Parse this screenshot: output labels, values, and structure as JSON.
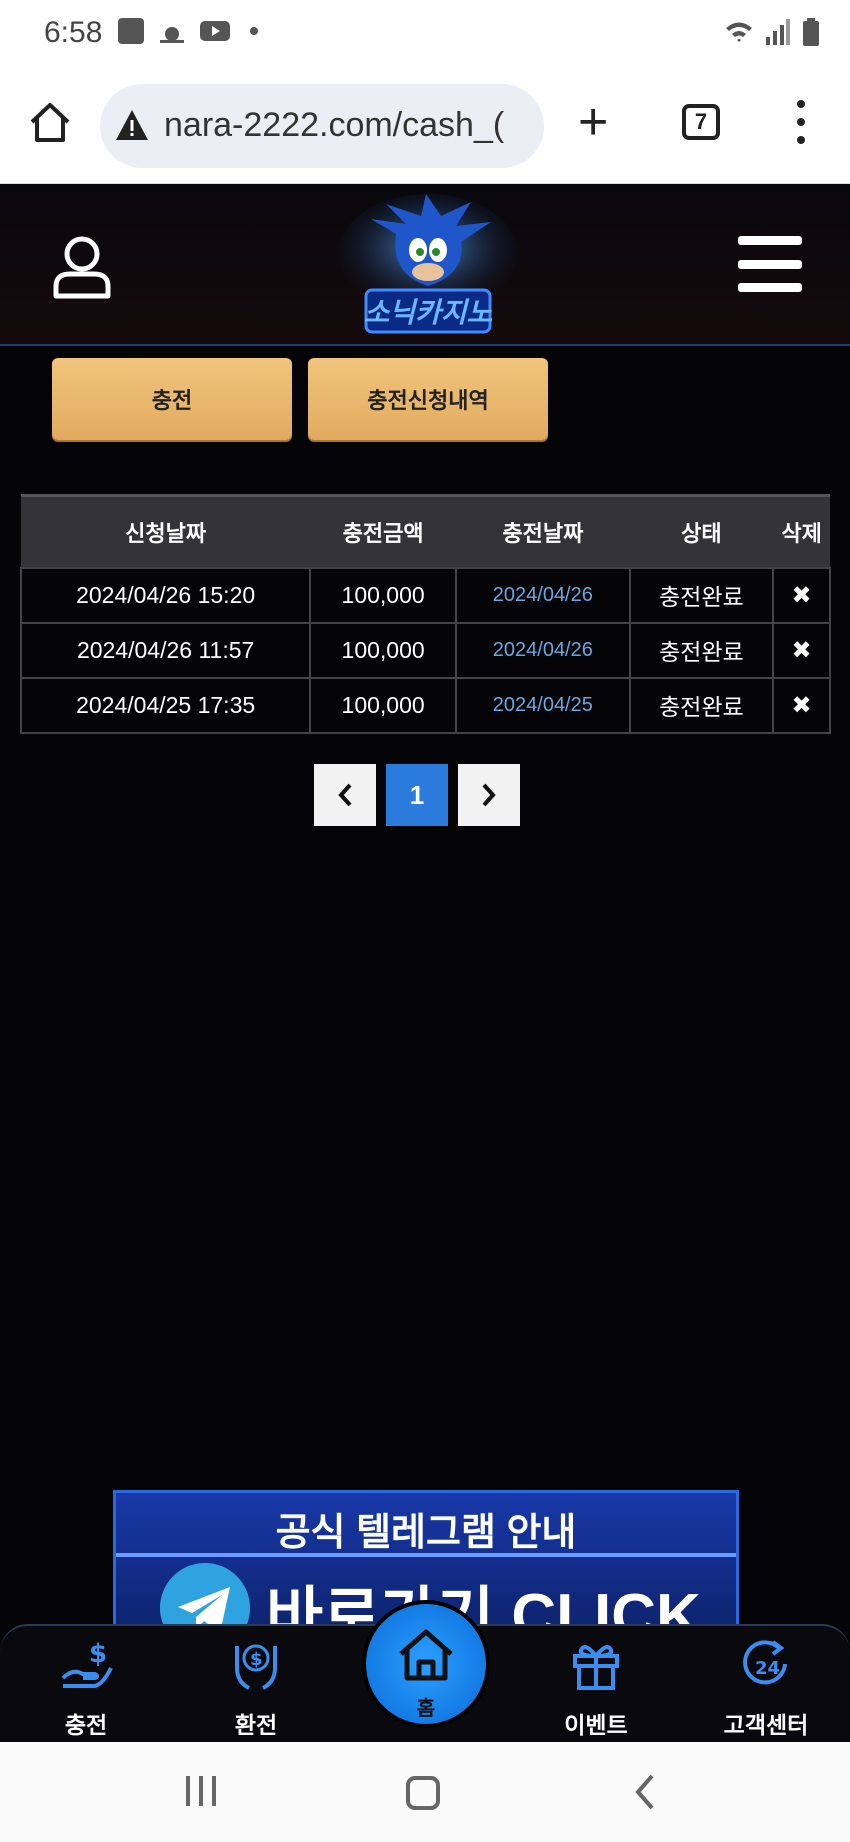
{
  "status_bar": {
    "time": "6:58"
  },
  "browser": {
    "url": "nara-2222.com/cash_(",
    "tab_count": "7"
  },
  "header": {
    "logo_text": "소닉카지노"
  },
  "tabs": [
    {
      "label": "충전"
    },
    {
      "label": "충전신청내역"
    }
  ],
  "table": {
    "headers": [
      "신청날짜",
      "충전금액",
      "충전날짜",
      "상태",
      "삭제"
    ],
    "rows": [
      {
        "request_date": "2024/04/26 15:20",
        "amount": "100,000",
        "charge_date": "2024/04/26",
        "status": "충전완료",
        "delete": "✖"
      },
      {
        "request_date": "2024/04/26 11:57",
        "amount": "100,000",
        "charge_date": "2024/04/26",
        "status": "충전완료",
        "delete": "✖"
      },
      {
        "request_date": "2024/04/25 17:35",
        "amount": "100,000",
        "charge_date": "2024/04/25",
        "status": "충전완료",
        "delete": "✖"
      }
    ]
  },
  "pagination": {
    "prev": "‹",
    "current": "1",
    "next": "›"
  },
  "banner": {
    "title": "공식 텔레그램 안내",
    "cta": "바로가기 CLICK"
  },
  "bottom_nav": [
    {
      "label": "충전",
      "icon": "deposit-icon"
    },
    {
      "label": "환전",
      "icon": "withdraw-icon"
    },
    {
      "label": "홈",
      "icon": "home-icon"
    },
    {
      "label": "이벤트",
      "icon": "gift-icon"
    },
    {
      "label": "고객센터",
      "icon": "support-24-icon"
    }
  ],
  "colors": {
    "gold": "#e8b86c",
    "accent_blue": "#2a7bdc",
    "link_blue": "#6aa6e0"
  }
}
